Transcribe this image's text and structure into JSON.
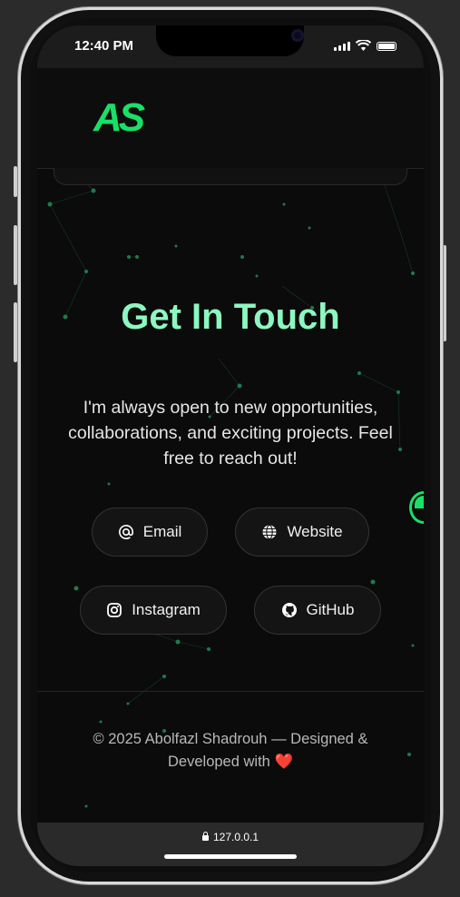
{
  "status": {
    "time": "12:40 PM"
  },
  "header": {
    "logo": "AS"
  },
  "main": {
    "title": "Get In Touch",
    "description": "I'm always open to new opportunities, collaborations, and exciting projects. Feel free to reach out!",
    "links": [
      {
        "label": "Email",
        "icon": "at-icon"
      },
      {
        "label": "Website",
        "icon": "globe-icon"
      },
      {
        "label": "Instagram",
        "icon": "instagram-icon"
      },
      {
        "label": "GitHub",
        "icon": "github-icon"
      }
    ]
  },
  "footer": {
    "text": "© 2025 Abolfazl Shadrouh — Designed & Developed with"
  },
  "browser": {
    "url": "127.0.0.1"
  },
  "colors": {
    "accent": "#19e066",
    "title": "#8cf7c0",
    "background": "#0b0b0b"
  }
}
